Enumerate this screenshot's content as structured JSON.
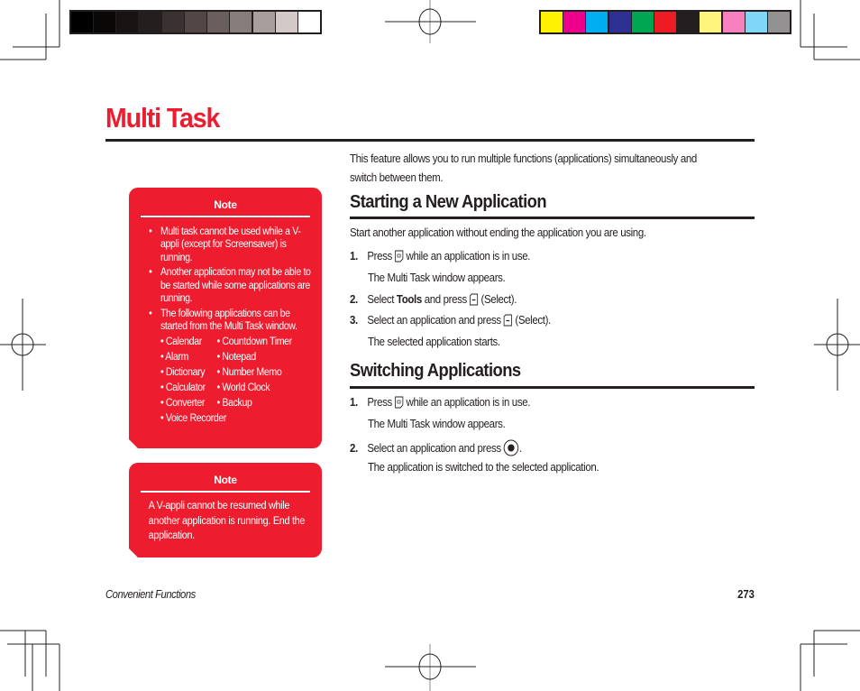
{
  "print_marks": {
    "gray_swatches": [
      "#000000",
      "#0a0807",
      "#161312",
      "#231f1e",
      "#3a3230",
      "#524746",
      "#6a5f5d",
      "#877d7b",
      "#a89e9c",
      "#d2c9c8",
      "#ffffff"
    ],
    "color_swatches": [
      "#fff200",
      "#ec008c",
      "#00aeef",
      "#2e3192",
      "#00a651",
      "#ed1c24",
      "#231f20",
      "#fff57d",
      "#f680c0",
      "#7fd6f7",
      "#939191"
    ]
  },
  "page": {
    "title": "Multi Task",
    "accent_color": "#ed1c2e",
    "intro": "This feature allows you to run multiple functions (applications) simultaneously and switch between them."
  },
  "notes": [
    {
      "title": "Note",
      "bullets": [
        "Multi task cannot be used while a V-appli (except for Screensaver) is running.",
        "Another application may not be able to be started while some applications are running.",
        "The following applications can be started from the Multi Task window."
      ],
      "apps": [
        "Calendar",
        "Countdown Timer",
        "Alarm",
        "Notepad",
        "Dictionary",
        "Number Memo",
        "Calculator",
        "World Clock",
        "Converter",
        "Backup",
        "Voice Recorder"
      ]
    },
    {
      "title": "Note",
      "body": "A V-appli cannot be resumed while another application is running. End the application."
    }
  ],
  "sections": [
    {
      "heading": "Starting a New Application",
      "lead": "Start another application without ending the application you are using.",
      "steps": [
        {
          "num": "1.",
          "pre": "Press",
          "key": "multitask-key-icon",
          "post": "while an application is in use.",
          "result": "The Multi Task window appears."
        },
        {
          "num": "2.",
          "pre": "Select",
          "bold": "Tools",
          "mid": "and press",
          "key": "softkey-icon",
          "post": "(Select)."
        },
        {
          "num": "3.",
          "pre": "Select an application and press",
          "key": "softkey-icon",
          "post": "(Select).",
          "result": "The selected application starts."
        }
      ]
    },
    {
      "heading": "Switching Applications",
      "steps": [
        {
          "num": "1.",
          "pre": "Press",
          "key": "multitask-key-icon",
          "post": "while an application is in use.",
          "result": "The Multi Task window appears."
        },
        {
          "num": "2.",
          "pre": "Select an application and press",
          "key": "center-key-icon",
          "post": ".",
          "result": "The application is switched to the selected application."
        }
      ]
    }
  ],
  "footer": {
    "section": "Convenient Functions",
    "page_number": "273"
  }
}
